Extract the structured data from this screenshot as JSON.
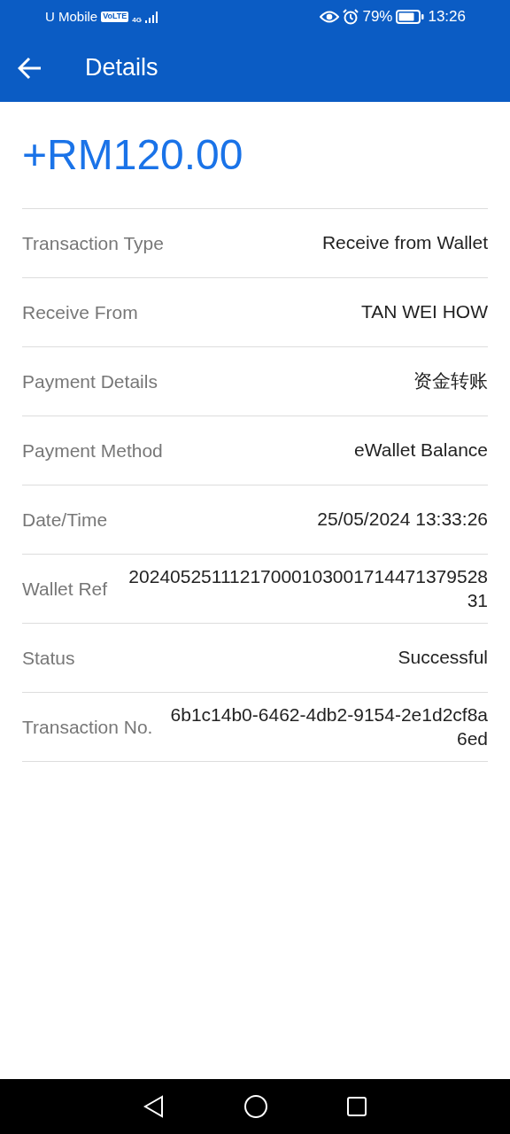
{
  "status_bar": {
    "carrier": "U Mobile",
    "volte": "VoLTE",
    "network": "4G",
    "battery": "79%",
    "time": "13:26"
  },
  "header": {
    "title": "Details"
  },
  "amount": "+RM120.00",
  "details": [
    {
      "label": "Transaction Type",
      "value": "Receive from Wallet"
    },
    {
      "label": "Receive From",
      "value": "TAN WEI HOW"
    },
    {
      "label": "Payment Details",
      "value": "资金转账"
    },
    {
      "label": "Payment Method",
      "value": "eWallet Balance"
    },
    {
      "label": "Date/Time",
      "value": "25/05/2024 13:33:26"
    },
    {
      "label": "Wallet Ref",
      "value": "2024052511121700010300171447137952831"
    },
    {
      "label": "Status",
      "value": "Successful"
    },
    {
      "label": "Transaction No.",
      "value": "6b1c14b0-6462-4db2-9154-2e1d2cf8a6ed"
    }
  ]
}
